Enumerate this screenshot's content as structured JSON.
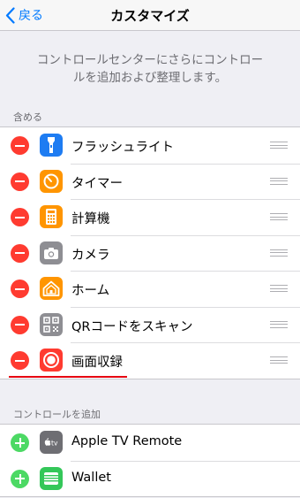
{
  "nav": {
    "back_label": "戻る",
    "title": "カスタマイズ"
  },
  "description": {
    "line1": "コントロールセンターにさらにコントロー",
    "line2": "ルを追加および整理します。"
  },
  "included": {
    "header": "含める",
    "items": [
      {
        "label": "フラッシュライト",
        "icon": "flashlight-icon",
        "color": "#1e7cf2"
      },
      {
        "label": "タイマー",
        "icon": "timer-icon",
        "color": "#ff9500"
      },
      {
        "label": "計算機",
        "icon": "calculator-icon",
        "color": "#ff9500"
      },
      {
        "label": "カメラ",
        "icon": "camera-icon",
        "color": "#8e8e93"
      },
      {
        "label": "ホーム",
        "icon": "home-icon",
        "color": "#ff9500"
      },
      {
        "label": "QRコードをスキャン",
        "icon": "qr-code-icon",
        "color": "#8e8e93"
      },
      {
        "label": "画面収録",
        "icon": "screen-recording-icon",
        "color": "#ff3b30"
      }
    ]
  },
  "more": {
    "header": "コントロールを追加",
    "items": [
      {
        "label": "Apple TV Remote",
        "icon": "apple-tv-remote-icon",
        "color": "#6e6e73"
      },
      {
        "label": "Wallet",
        "icon": "wallet-icon",
        "color": "#34c759"
      }
    ]
  },
  "colors": {
    "remove": "#ff3b30",
    "add": "#4cd964",
    "accent": "#007aff",
    "highlight": "#e60012"
  }
}
